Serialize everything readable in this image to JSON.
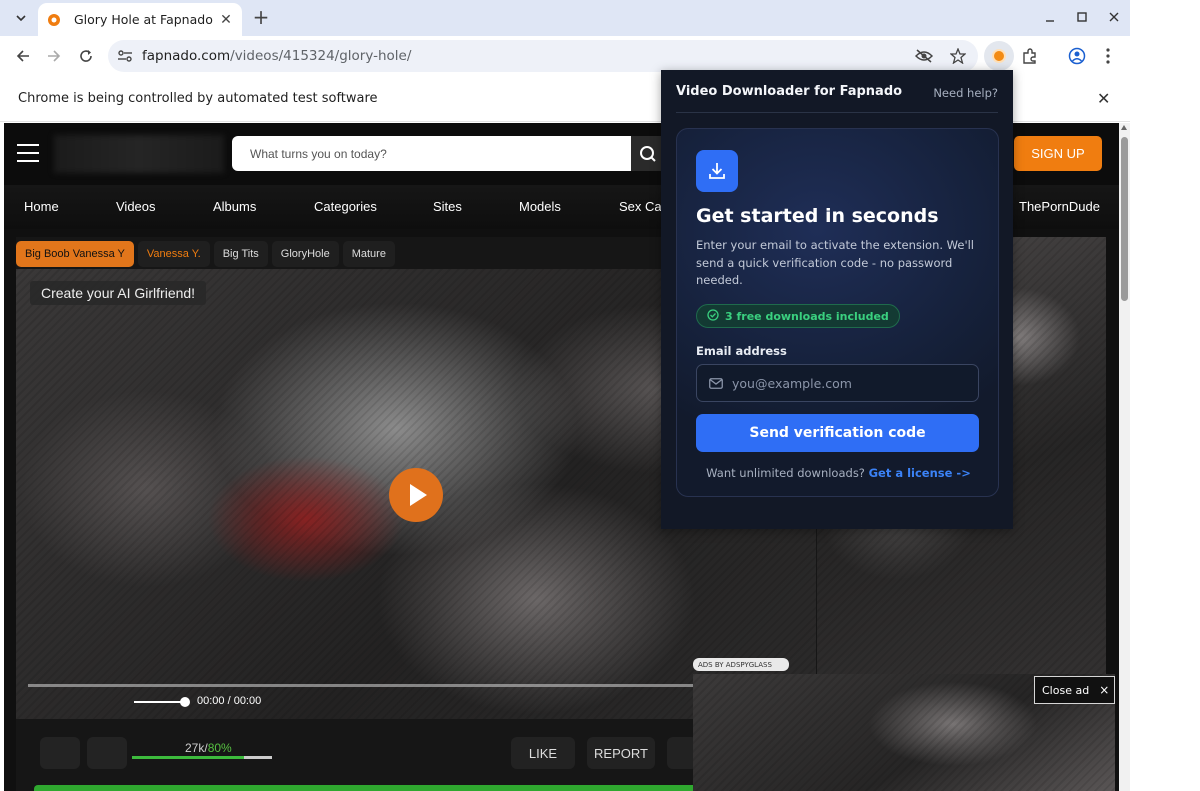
{
  "browser": {
    "tab_title": "Glory Hole at Fapnado",
    "url_host": "fapnado.com",
    "url_path": "/videos/415324/glory-hole/",
    "infobar_text": "Chrome is being controlled by automated test software",
    "icons": [
      "tab-search-icon",
      "close-icon",
      "plus-icon",
      "minimize-icon",
      "maximize-icon",
      "back-icon",
      "forward-icon",
      "reload-icon",
      "site-settings-icon",
      "eye-off-icon",
      "star-icon",
      "extension-icon",
      "puzzle-icon",
      "profile-icon",
      "kebab-menu-icon"
    ]
  },
  "site": {
    "search_placeholder": "What turns you on today?",
    "signup_label": "SIGN UP",
    "nav": [
      "Home",
      "Videos",
      "Albums",
      "Categories",
      "Sites",
      "Models",
      "Sex Cam",
      "ThePornDude"
    ],
    "tags": [
      "Big Boob Vanessa Y",
      "Vanessa Y.",
      "Big Tits",
      "GloryHole",
      "Mature"
    ],
    "ai_button": "Create your AI Girlfriend!",
    "time": "00:00 / 00:00",
    "rating_count": "27k/",
    "rating_pct": "80%",
    "rating_value": 0.8,
    "like_label": "LIKE",
    "report_label": "REPORT",
    "ads_label": "ADS BY ADSPYGLASS",
    "close_ad_label": "Close ad",
    "close_ad_x": "×",
    "accent_color": "#f07d10"
  },
  "popup": {
    "title": "Video Downloader for Fapnado",
    "help": "Need help?",
    "heading": "Get started in seconds",
    "description": "Enter your email to activate the extension. We'll send a quick verification code - no password needed.",
    "badge": "3 free downloads included",
    "email_label": "Email address",
    "email_placeholder": "you@example.com",
    "send_button": "Send verification code",
    "footer_text": "Want unlimited downloads?",
    "footer_link": "Get a license ->",
    "accent_color": "#2f6ef5"
  }
}
